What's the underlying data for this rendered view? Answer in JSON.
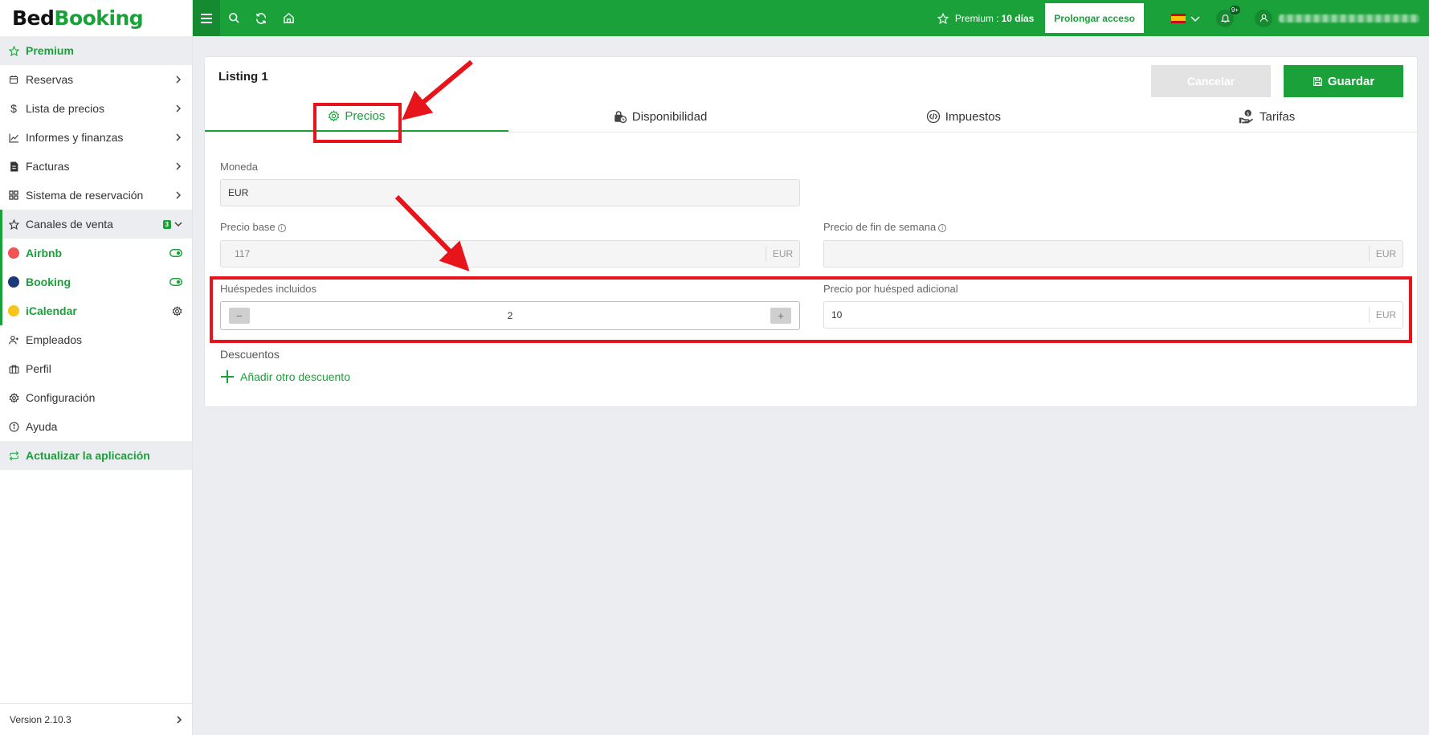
{
  "app": {
    "logo_part1": "Bed",
    "logo_part2": "Booking"
  },
  "sidebar": {
    "premium": "Premium",
    "items": [
      {
        "label": "Reservas"
      },
      {
        "label": "Lista de precios"
      },
      {
        "label": "Informes y finanzas"
      },
      {
        "label": "Facturas"
      },
      {
        "label": "Sistema de reservación"
      },
      {
        "label": "Canales de venta",
        "badge": "3"
      }
    ],
    "channels": [
      {
        "label": "Airbnb",
        "color": "#f05454"
      },
      {
        "label": "Booking",
        "color": "#1c3a7a"
      },
      {
        "label": "iCalendar",
        "color": "#f5c518"
      }
    ],
    "bottom_items": [
      {
        "label": "Empleados"
      },
      {
        "label": "Perfil"
      },
      {
        "label": "Configuración"
      },
      {
        "label": "Ayuda"
      }
    ],
    "update": "Actualizar la aplicación",
    "version": "Version 2.10.3"
  },
  "topbar": {
    "premium_label": "Premium :",
    "premium_days": "10 días",
    "prolong": "Prolongar acceso",
    "notif_count": "9+"
  },
  "card": {
    "title": "Listing 1",
    "cancel": "Cancelar",
    "save": "Guardar",
    "tabs": [
      "Precios",
      "Disponibilidad",
      "Impuestos",
      "Tarifas"
    ],
    "currency_label": "Moneda",
    "currency_value": "EUR",
    "base_price_label": "Precio base",
    "base_price_value": "117",
    "base_price_unit": "EUR",
    "weekend_label": "Precio de fin de semana",
    "weekend_unit": "EUR",
    "guests_label": "Huéspedes incluidos",
    "guests_value": "2",
    "extra_label": "Precio por huésped adicional",
    "extra_value": "10",
    "extra_unit": "EUR",
    "discounts_label": "Descuentos",
    "add_discount": "Añadir otro descuento"
  },
  "colors": {
    "accent": "#1aa13a",
    "annotation": "#e8141c"
  }
}
